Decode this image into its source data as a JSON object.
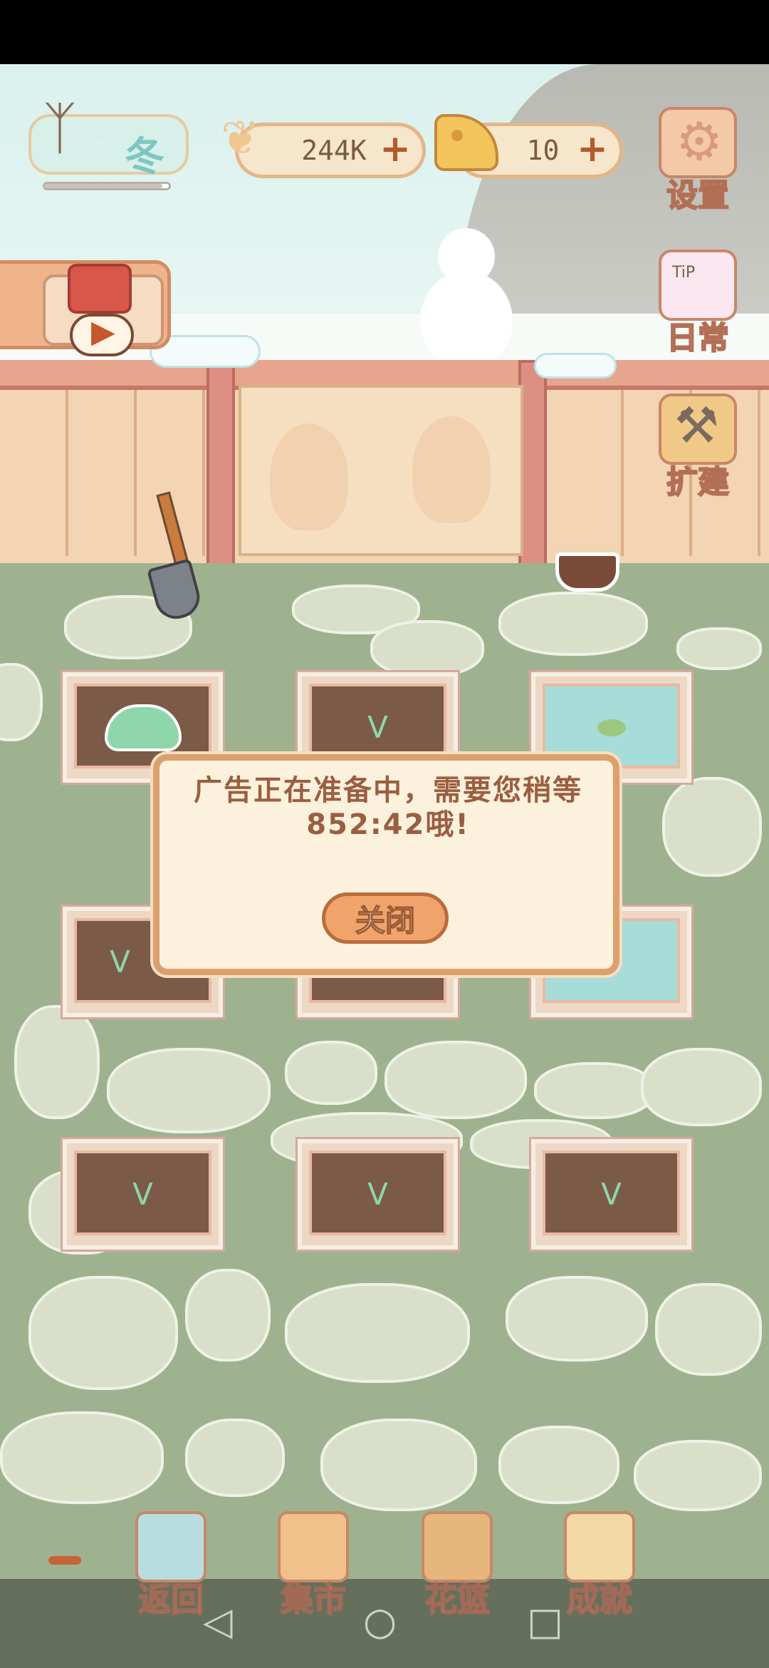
{
  "hud": {
    "season": {
      "label": "冬",
      "progress": 0.95
    },
    "fish": {
      "value": "244K",
      "plus": "+"
    },
    "cheese": {
      "value": "10",
      "plus": "+"
    }
  },
  "side_menu": {
    "settings": "设置",
    "daily": "日常",
    "daily_tip": "TiP",
    "expand": "扩建"
  },
  "dialog": {
    "message": "广告正在准备中，需要您稍等852:42哦!",
    "close": "关闭"
  },
  "bottom_nav": {
    "items": [
      "返回",
      "集市",
      "花篮",
      "成就"
    ]
  },
  "system_nav": {
    "back": "◁",
    "home": "○",
    "recent": "□"
  },
  "colors": {
    "ground": "#9fb28f",
    "dialog_bg": "#fcf1dc",
    "accent": "#f0a36a",
    "text_brown": "#9a5f40"
  }
}
